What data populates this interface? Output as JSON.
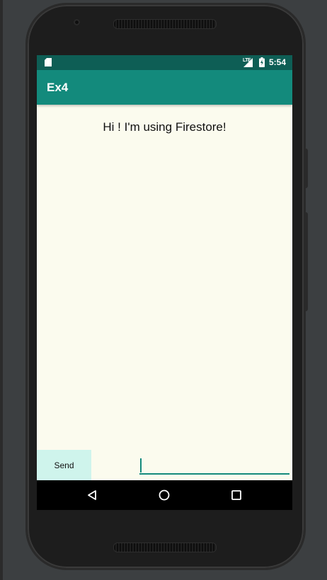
{
  "status_bar": {
    "time": "5:54",
    "network_label": "LTE",
    "icons": [
      "sd-card-icon",
      "signal-icon",
      "battery-charging-icon"
    ]
  },
  "app_bar": {
    "title": "Ex4"
  },
  "main": {
    "message": "Hi ! I'm using Firestore!"
  },
  "input_row": {
    "send_label": "Send",
    "field_value": ""
  },
  "nav_bar": {
    "icons": [
      "back-icon",
      "home-icon",
      "recents-icon"
    ]
  },
  "colors": {
    "status_bar": "#0e5e55",
    "app_bar": "#138a7c",
    "screen_background": "#fbfbee",
    "send_button": "#cff4ec",
    "nav_bar": "#000000"
  }
}
